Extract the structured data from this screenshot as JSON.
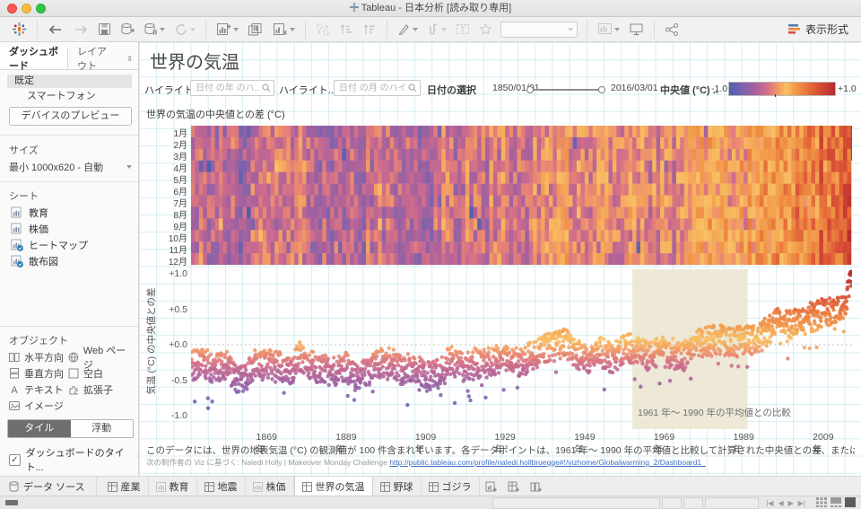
{
  "window": {
    "title": "Tableau - 日本分析 [読み取り専用]"
  },
  "toolbar": {
    "show_me_label": "表示形式",
    "combo_value": ""
  },
  "sidebar": {
    "tabs": [
      {
        "label": "ダッシュボード"
      },
      {
        "label": "レイアウト"
      }
    ],
    "device": {
      "default_label": "既定",
      "phone_label": "スマートフォン",
      "preview_button": "デバイスのプレビュー"
    },
    "size": {
      "heading": "サイズ",
      "value": "最小 1000x620 - 自動"
    },
    "sheets": {
      "heading": "シート",
      "items": [
        {
          "label": "教育",
          "in_dashboard": false
        },
        {
          "label": "株価",
          "in_dashboard": false
        },
        {
          "label": "ヒートマップ",
          "in_dashboard": true
        },
        {
          "label": "散布図",
          "in_dashboard": true
        }
      ]
    },
    "objects": {
      "heading": "オブジェクト",
      "items": [
        {
          "label": "水平方向",
          "icon": "horizontal-container-icon"
        },
        {
          "label": "Web ページ",
          "icon": "web-page-icon"
        },
        {
          "label": "垂直方向",
          "icon": "vertical-container-icon"
        },
        {
          "label": "空白",
          "icon": "blank-icon"
        },
        {
          "label": "テキスト",
          "icon": "text-icon"
        },
        {
          "label": "拡張子",
          "icon": "extension-icon"
        },
        {
          "label": "イメージ",
          "icon": "image-icon"
        }
      ]
    },
    "layout_toggle": {
      "tiled": "タイル",
      "floating": "浮動"
    },
    "title_checkbox_label": "ダッシュボードのタイト...",
    "title_checkbox_checked": true
  },
  "dashboard": {
    "title": "世界の気温",
    "filters": {
      "highlight_year_label": "ハイライト..",
      "highlight_year_placeholder": "日付 の年 のハ...",
      "highlight_month_label": "ハイライト..",
      "highlight_month_placeholder": "日付 の月 のハイラ...",
      "date_label": "日付の選択",
      "date_start": "1850/01/01",
      "date_end": "2016/03/01",
      "legend_label": "中央値 (°C) ..",
      "legend_min": "-1.0",
      "legend_max": "+1.0"
    },
    "caption_line1": "このデータには、世界の地表気温 (°C) の観測値が 100 件含まれています。各データポイントは、1961 年〜 1990 年の平均値と比較して計算された中央値との差、または偏差を表します。",
    "caption_line2_prefix": "次の制作者の Viz に基づく: Naledi Holly | Makeover Monday Challenge ",
    "caption_link": "http://public.tableau.com/profile/naledi.hollbruegge#!/vizhome/Globalwarming_2/Dashboard1_"
  },
  "chart_data": [
    {
      "type": "heatmap",
      "title": "世界の気温の中央値との差 (°C)",
      "rows": [
        "1月",
        "2月",
        "3月",
        "4月",
        "5月",
        "6月",
        "7月",
        "8月",
        "9月",
        "10月",
        "11月",
        "12月"
      ],
      "x_range": [
        1850,
        2016
      ],
      "last_year_months": 3,
      "unit": "°C 中央値との差",
      "color_scale": {
        "domain": [
          -1.0,
          1.0
        ],
        "stops": [
          [
            -1.0,
            "#4e5fb0"
          ],
          [
            -0.7,
            "#8263ab"
          ],
          [
            -0.5,
            "#a5619e"
          ],
          [
            -0.3,
            "#cc6b8d"
          ],
          [
            -0.15,
            "#e88573"
          ],
          [
            -0.02,
            "#f6a75e"
          ],
          [
            0.08,
            "#f8c063"
          ],
          [
            0.25,
            "#f29b4b"
          ],
          [
            0.45,
            "#e97a3c"
          ],
          [
            0.65,
            "#dc5737"
          ],
          [
            0.85,
            "#c93c33"
          ],
          [
            1.2,
            "#a8232e"
          ]
        ]
      }
    },
    {
      "type": "scatter",
      "ylabel": "気温 (°C) の中央値との差",
      "y_ticks": [
        "+1.0",
        "+0.5",
        "+0.0",
        "-0.5",
        "-1.0"
      ],
      "y_tick_values": [
        1.0,
        0.5,
        0.0,
        -0.5,
        -1.0
      ],
      "ylim": [
        -1.19,
        1.06
      ],
      "x_ticks": [
        "1869年",
        "1889年",
        "1909年",
        "1929年",
        "1949年",
        "1969年",
        "1989年",
        "2009年"
      ],
      "x_tick_values": [
        1869,
        1889,
        1909,
        1929,
        1949,
        1969,
        1989,
        2009
      ],
      "x_range": [
        1850,
        2016.25
      ],
      "points_per_year": 12,
      "reference_band": {
        "x_start": 1961,
        "x_end": 1990,
        "label": "1961 年〜 1990 年の平均値との比較",
        "color": "#ece6d3"
      },
      "zero_line": 0.0,
      "monthly_spread": 0.42,
      "annual_anomaly_trend": [
        [
          1850,
          -0.3
        ],
        [
          1853,
          -0.25
        ],
        [
          1856,
          -0.33
        ],
        [
          1859,
          -0.3
        ],
        [
          1862,
          -0.5
        ],
        [
          1864,
          -0.42
        ],
        [
          1866,
          -0.28
        ],
        [
          1869,
          -0.27
        ],
        [
          1872,
          -0.3
        ],
        [
          1875,
          -0.38
        ],
        [
          1877,
          -0.15
        ],
        [
          1880,
          -0.28
        ],
        [
          1883,
          -0.35
        ],
        [
          1886,
          -0.38
        ],
        [
          1889,
          -0.3
        ],
        [
          1891,
          -0.45
        ],
        [
          1894,
          -0.4
        ],
        [
          1897,
          -0.28
        ],
        [
          1900,
          -0.22
        ],
        [
          1903,
          -0.38
        ],
        [
          1906,
          -0.3
        ],
        [
          1909,
          -0.45
        ],
        [
          1912,
          -0.42
        ],
        [
          1915,
          -0.22
        ],
        [
          1918,
          -0.32
        ],
        [
          1921,
          -0.25
        ],
        [
          1924,
          -0.28
        ],
        [
          1927,
          -0.2
        ],
        [
          1930,
          -0.15
        ],
        [
          1933,
          -0.25
        ],
        [
          1936,
          -0.15
        ],
        [
          1939,
          -0.05
        ],
        [
          1942,
          -0.02
        ],
        [
          1944,
          0.02
        ],
        [
          1947,
          -0.12
        ],
        [
          1950,
          -0.2
        ],
        [
          1953,
          -0.1
        ],
        [
          1956,
          -0.2
        ],
        [
          1959,
          -0.06
        ],
        [
          1962,
          -0.05
        ],
        [
          1965,
          -0.15
        ],
        [
          1968,
          -0.1
        ],
        [
          1971,
          -0.12
        ],
        [
          1974,
          -0.18
        ],
        [
          1977,
          0.02
        ],
        [
          1980,
          0.05
        ],
        [
          1983,
          0.08
        ],
        [
          1986,
          0.02
        ],
        [
          1989,
          0.08
        ],
        [
          1992,
          0.05
        ],
        [
          1995,
          0.2
        ],
        [
          1998,
          0.35
        ],
        [
          2001,
          0.3
        ],
        [
          2004,
          0.35
        ],
        [
          2007,
          0.4
        ],
        [
          2010,
          0.48
        ],
        [
          2012,
          0.42
        ],
        [
          2014,
          0.55
        ],
        [
          2015,
          0.68
        ],
        [
          2016,
          1.05
        ]
      ]
    }
  ],
  "tabs_bar": {
    "datasource_label": "データ ソース",
    "tabs": [
      {
        "label": "産業",
        "type": "dashboard",
        "active": false
      },
      {
        "label": "教育",
        "type": "worksheet",
        "active": false
      },
      {
        "label": "地震",
        "type": "dashboard",
        "active": false
      },
      {
        "label": "株価",
        "type": "worksheet",
        "active": false
      },
      {
        "label": "世界の気温",
        "type": "dashboard",
        "active": true
      },
      {
        "label": "野球",
        "type": "dashboard",
        "active": false
      },
      {
        "label": "ゴジラ",
        "type": "dashboard",
        "active": false
      }
    ]
  }
}
